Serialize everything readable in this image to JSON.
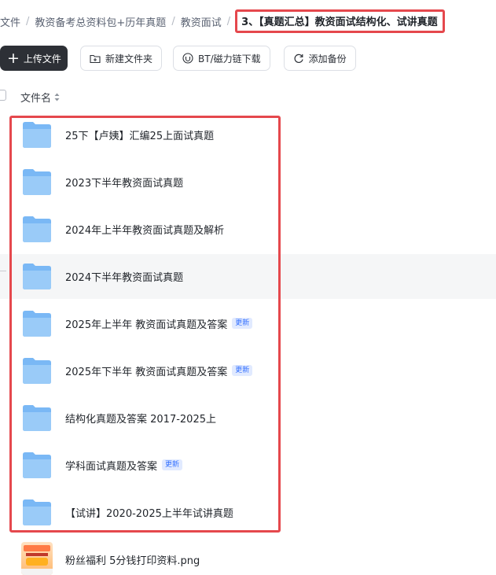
{
  "breadcrumb": {
    "items": [
      "文件",
      "教资备考总资料包+历年真题",
      "教资面试"
    ],
    "separator": "/",
    "current": "3、【真题汇总】教资面试结构化、试讲真题"
  },
  "toolbar": {
    "upload_label": "上传文件",
    "new_folder_label": "新建文件夹",
    "bt_download_label": "BT/磁力链下载",
    "add_backup_label": "添加备份"
  },
  "list_header": {
    "name_column": "文件名"
  },
  "files": [
    {
      "name": "25下【卢姨】汇编25上面试真题",
      "type": "folder",
      "badge": ""
    },
    {
      "name": "2023下半年教资面试真题",
      "type": "folder",
      "badge": ""
    },
    {
      "name": "2024年上半年教资面试真题及解析",
      "type": "folder",
      "badge": ""
    },
    {
      "name": "2024下半年教资面试真题",
      "type": "folder",
      "badge": ""
    },
    {
      "name": "2025年上半年 教资面试真题及答案",
      "type": "folder",
      "badge": "更新"
    },
    {
      "name": "2025年下半年 教资面试真题及答案",
      "type": "folder",
      "badge": "更新"
    },
    {
      "name": "结构化真题及答案 2017-2025上",
      "type": "folder",
      "badge": ""
    },
    {
      "name": "学科面试真题及答案",
      "type": "folder",
      "badge": "更新"
    },
    {
      "name": "【试讲】2020-2025上半年试讲真题",
      "type": "folder",
      "badge": ""
    },
    {
      "name": "粉丝福利 5分钱打印资料.png",
      "type": "image",
      "badge": ""
    }
  ],
  "colors": {
    "accent_red": "#e5484d",
    "folder_blue": "#7ab8f5",
    "badge_blue": "#3370ff",
    "upload_button": "#2d3036"
  }
}
